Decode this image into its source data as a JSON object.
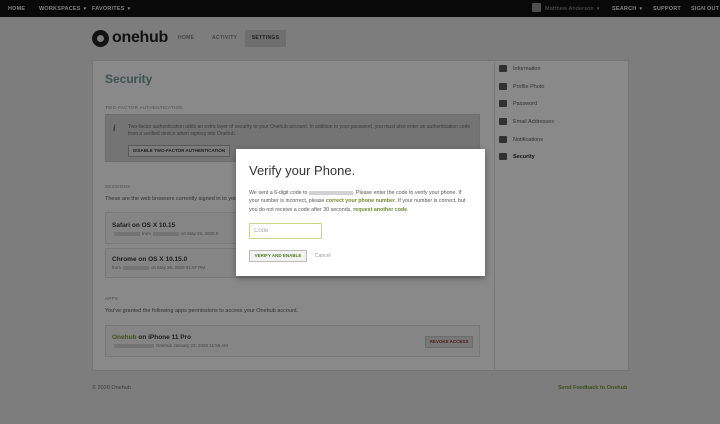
{
  "topbar": {
    "home": "HOME",
    "workspaces": "WORKSPACES",
    "favorites": "FAVORITES",
    "user": "Matthew Anderson",
    "search": "SEARCH",
    "support": "SUPPORT",
    "signout": "SIGN OUT"
  },
  "brand": {
    "name": "onehub"
  },
  "nav": {
    "home": "HOME",
    "activity": "ACTIVITY",
    "settings": "SETTINGS"
  },
  "main": {
    "title": "Security",
    "tfa_label": "TWO-FACTOR AUTHENTICATION",
    "tfa_text": "Two-factor authentication adds an extra layer of security to your Onehub account. In addition to your password, you must also enter an authentication code from a verified device when signing into Onehub.",
    "tfa_button": "DISABLE TWO-FACTOR AUTHENTICATION",
    "sessions_label": "SESSIONS",
    "sessions_text": "These are the web browsers currently signed in to your",
    "sessions": [
      {
        "name": "Safari on OS X 10.15",
        "meta_prefix": "from",
        "meta_suffix": "on May 29, 2020 0"
      },
      {
        "name": "Chrome on OS X 10.15.0",
        "meta_prefix": "from",
        "meta_suffix": "on May 29, 2020 01:07 PM"
      }
    ],
    "apps_label": "APPS",
    "apps_text": "You've granted the following apps permissions to access your Onehub account.",
    "app": {
      "name_link": "Onehub",
      "name_rest": " on iPhone 11 Pro",
      "meta": "Onehub January 23, 2020 11:56 AM",
      "revoke": "REVOKE ACCESS"
    }
  },
  "sidebar": {
    "items": [
      {
        "label": "Information",
        "icon": "info-icon"
      },
      {
        "label": "Profile Photo",
        "icon": "photo-icon"
      },
      {
        "label": "Password",
        "icon": "key-icon"
      },
      {
        "label": "Email Addresses",
        "icon": "mail-icon"
      },
      {
        "label": "Notifications",
        "icon": "bell-icon"
      },
      {
        "label": "Security",
        "icon": "lock-icon"
      }
    ]
  },
  "footer": {
    "copyright": "© 2020 Onehub",
    "feedback": "Send Feedback to Onehub"
  },
  "modal": {
    "title": "Verify your Phone.",
    "text_1": "We sent a 6-digit code to",
    "text_2": ". Please enter the code to verify your phone. If your number is incorrect, please ",
    "link_correct": "correct your phone number",
    "text_3": ". If your number is correct, but you do not receive a code after 30 seconds, ",
    "link_request": "request another code",
    "text_4": ".",
    "code_placeholder": "Code",
    "verify_button": "VERIFY AND ENABLE",
    "cancel": "Cancel"
  },
  "colors": {
    "accent_green": "#6a8c2e",
    "title_teal": "#6a8f8a",
    "danger": "#8a2f2f"
  }
}
